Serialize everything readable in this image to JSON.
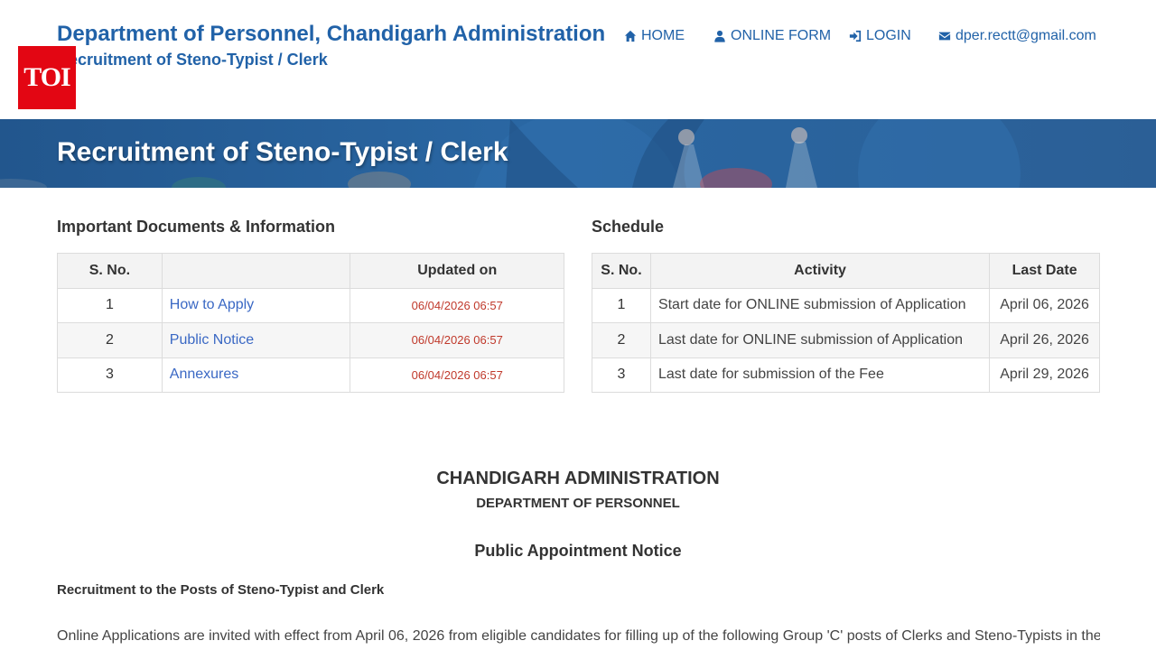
{
  "header": {
    "title": "Department of Personnel, Chandigarh Administration",
    "subtitle": "Recruitment of Steno-Typist / Clerk",
    "logo_text": "TOI",
    "colors": {
      "brand_blue": "#2162a8",
      "logo_red": "#e30613"
    }
  },
  "nav": {
    "home": {
      "label": "HOME",
      "icon": "home-icon"
    },
    "online_form": {
      "label": "ONLINE FORM",
      "icon": "user-icon"
    },
    "login": {
      "label": "LOGIN",
      "icon": "sign-in-icon"
    },
    "email": {
      "label": "dper.rectt@gmail.com",
      "icon": "envelope-icon"
    }
  },
  "banner": {
    "title": "Recruitment of Steno-Typist / Clerk"
  },
  "documents": {
    "heading": "Important Documents & Information",
    "columns": [
      "S. No.",
      "",
      "Updated on"
    ],
    "rows": [
      {
        "sno": "1",
        "name": "How to Apply",
        "updated": "06/04/2026 06:57"
      },
      {
        "sno": "2",
        "name": "Public Notice",
        "updated": "06/04/2026 06:57"
      },
      {
        "sno": "3",
        "name": "Annexures",
        "updated": "06/04/2026 06:57"
      }
    ]
  },
  "schedule": {
    "heading": "Schedule",
    "columns": [
      "S. No.",
      "Activity",
      "Last Date"
    ],
    "rows": [
      {
        "sno": "1",
        "activity": "Start date for ONLINE submission of Application",
        "date": "April 06, 2026"
      },
      {
        "sno": "2",
        "activity": "Last date for ONLINE submission of Application",
        "date": "April 26, 2026"
      },
      {
        "sno": "3",
        "activity": "Last date for submission of the Fee",
        "date": "April 29, 2026"
      }
    ]
  },
  "notice": {
    "title": "CHANDIGARH ADMINISTRATION",
    "department": "DEPARTMENT OF PERSONNEL",
    "heading": "Public Appointment Notice",
    "subheading": "Recruitment to the Posts of Steno-Typist and Clerk",
    "body": "Online Applications are invited with effect from April 06, 2026 from eligible candidates for filling up of the following Group 'C' posts of Clerks and Steno-Typists in the"
  }
}
